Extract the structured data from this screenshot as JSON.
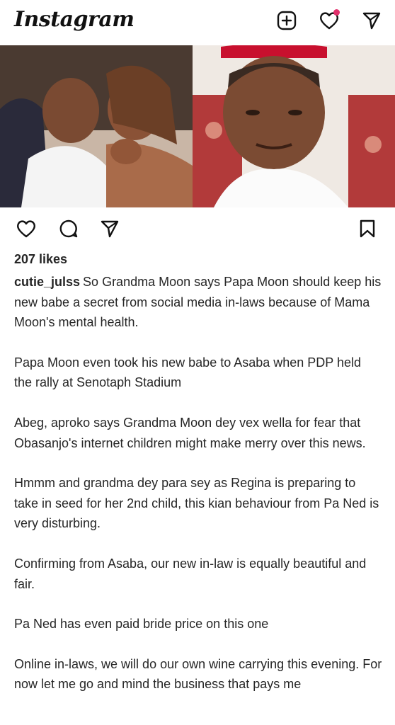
{
  "app": {
    "title": "Instagram"
  },
  "top_icons": [
    "new-post-icon",
    "activity-heart-icon",
    "direct-message-icon"
  ],
  "colors": {
    "notification_dot": "#e1306c",
    "text": "#262626"
  },
  "post": {
    "likes": "207 likes",
    "username": "cutie_julss",
    "paragraphs": [
      "So Grandma Moon says Papa Moon should keep his new babe a secret from social media in-laws because of Mama Moon's mental health.",
      "Papa Moon even took his new babe to  Asaba when PDP held the rally at Senotaph Stadium",
      "Abeg, aproko says Grandma Moon dey vex wella for fear that Obasanjo's internet children might make merry over this news.",
      "Hmmm and grandma dey para sey as Regina is preparing to take in seed for her 2nd child, this kian behaviour from Pa Ned is very disturbing.",
      "Confirming from Asaba, our new in-law is equally beautiful and fair.",
      "Pa Ned has even paid bride price on this one",
      "Online in-laws, we will do our own wine carrying this evening. For now let me go and mind the business that pays me"
    ]
  }
}
